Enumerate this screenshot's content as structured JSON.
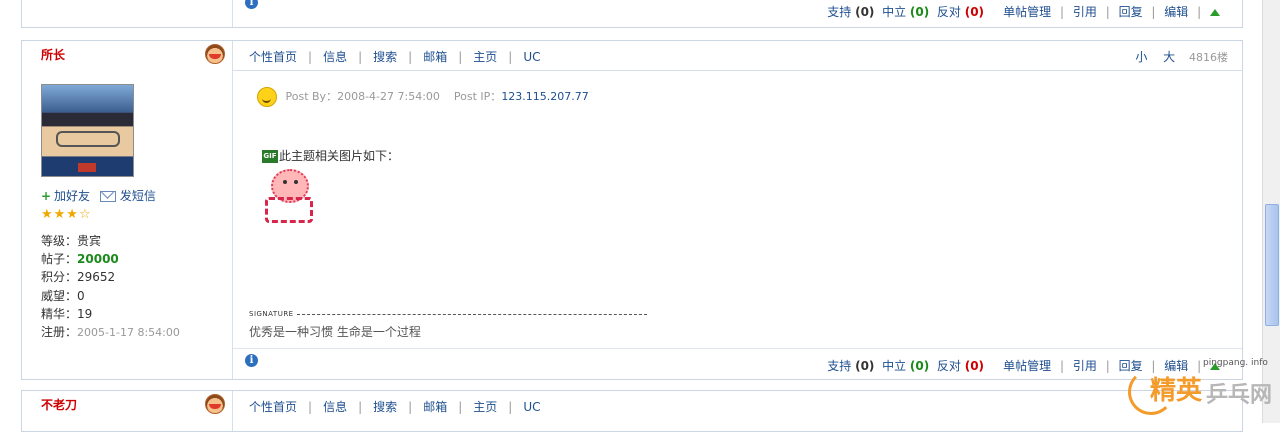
{
  "prev_post": {
    "footer": {
      "support_label": "支持",
      "support_count": "(0)",
      "neutral_label": "中立",
      "neutral_count": "(0)",
      "oppose_label": "反对",
      "oppose_count": "(0)",
      "manage_label": "单帖管理",
      "quote_label": "引用",
      "reply_label": "回复",
      "edit_label": "编辑",
      "separator": "|"
    }
  },
  "post": {
    "username": "所长",
    "nav": {
      "home": "个性首页",
      "info": "信息",
      "search": "搜索",
      "mailbox": "邮箱",
      "homepage": "主页",
      "uc": "UC",
      "separator": "|"
    },
    "font_small": "小",
    "font_large": "大",
    "floor": "4816楼",
    "user": {
      "add_friend": "加好友",
      "send_message": "发短信",
      "stars": "★★★☆",
      "level_label": "等级：",
      "level_value": "贵宾",
      "posts_label": "帖子：",
      "posts_value": "20000",
      "points_label": "积分：",
      "points_value": "29652",
      "prestige_label": "威望：",
      "prestige_value": "0",
      "elite_label": "精华：",
      "elite_value": "19",
      "registered_label": "注册：",
      "registered_value": "2005-1-17 8:54:00"
    },
    "meta": {
      "post_by_label": "Post By：",
      "post_by_value": "2008-4-27 7:54:00",
      "post_ip_label": "Post IP：",
      "post_ip_value": "123.115.207.77"
    },
    "attachment_text": "此主题相关图片如下：",
    "gif_label": "GIF",
    "signature_label": "SIGNATURE",
    "signature_text": "优秀是一种习惯 生命是一个过程",
    "footer": {
      "support_label": "支持",
      "support_count": "(0)",
      "neutral_label": "中立",
      "neutral_count": "(0)",
      "oppose_label": "反对",
      "oppose_count": "(0)",
      "manage_label": "单帖管理",
      "quote_label": "引用",
      "reply_label": "回复",
      "edit_label": "编辑",
      "separator": "|"
    }
  },
  "next_post": {
    "username": "不老刀",
    "nav": {
      "home": "个性首页",
      "info": "信息",
      "search": "搜索",
      "mailbox": "邮箱",
      "homepage": "主页",
      "uc": "UC",
      "separator": "|"
    }
  },
  "watermark": {
    "small": "pingpang. info",
    "logo_main": "精英",
    "logo_rest": "乒乓网"
  }
}
